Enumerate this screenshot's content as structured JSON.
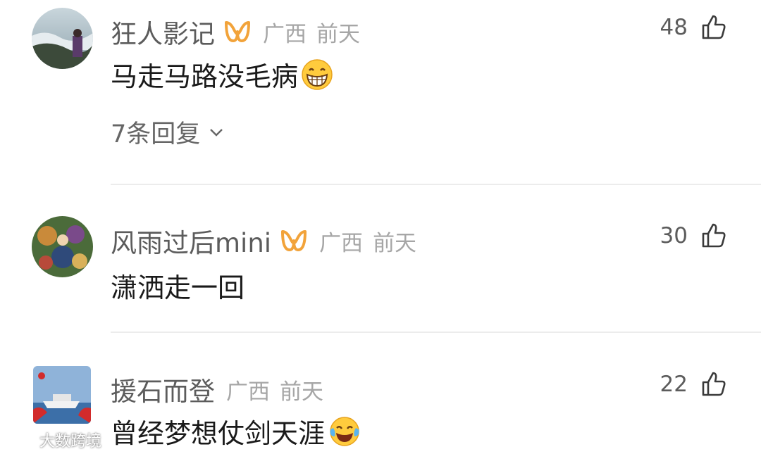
{
  "comments": [
    {
      "username": "狂人影记",
      "vip": true,
      "location": "广西",
      "time": "前天",
      "likes": "48",
      "text": "马走马路没毛病",
      "emoji": "grinning-face",
      "replies_label": "7条回复"
    },
    {
      "username": "风雨过后mini",
      "vip": true,
      "location": "广西",
      "time": "前天",
      "likes": "30",
      "text": "潇洒走一回"
    },
    {
      "username": "援石而登",
      "vip": false,
      "location": "广西",
      "time": "前天",
      "likes": "22",
      "text": "曾经梦想仗剑天涯",
      "emoji": "laughing-tears-face"
    }
  ],
  "watermark": "大数跨境",
  "colors": {
    "vip": "#f2a33a",
    "meta": "#a6a6a6",
    "username": "#5c5c5c"
  }
}
